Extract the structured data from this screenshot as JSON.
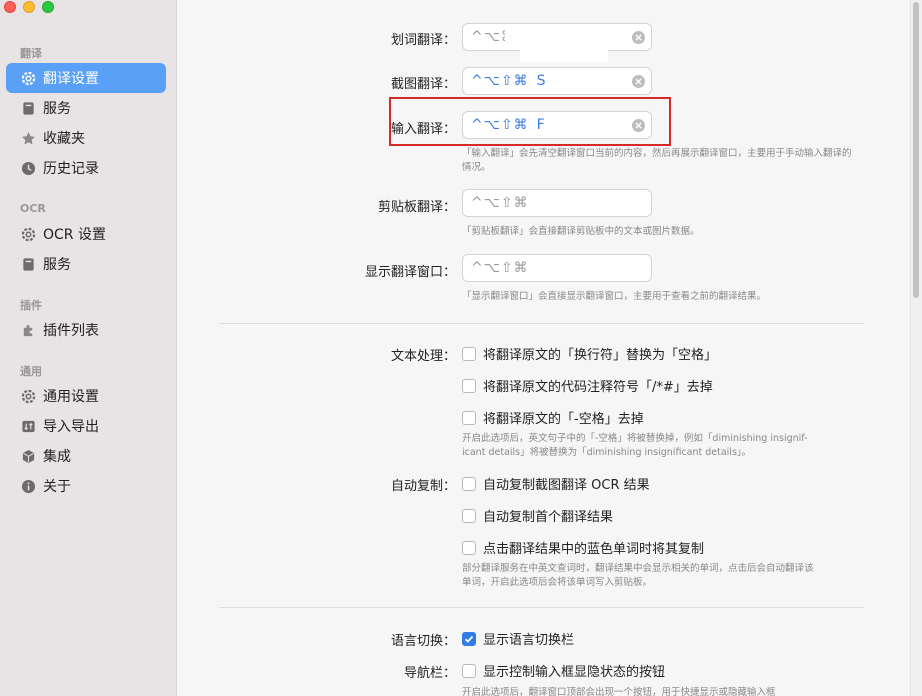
{
  "sidebar": {
    "sections": [
      {
        "title": "翻译",
        "items": [
          {
            "label": "翻译设置",
            "icon": "gear-icon",
            "active": true
          },
          {
            "label": "服务",
            "icon": "bookmark-icon"
          },
          {
            "label": "收藏夹",
            "icon": "star-icon"
          },
          {
            "label": "历史记录",
            "icon": "clock-icon"
          }
        ]
      },
      {
        "title": "OCR",
        "items": [
          {
            "label": "OCR 设置",
            "icon": "gear-icon"
          },
          {
            "label": "服务",
            "icon": "bookmark-icon"
          }
        ]
      },
      {
        "title": "插件",
        "items": [
          {
            "label": "插件列表",
            "icon": "puzzle-icon"
          }
        ]
      },
      {
        "title": "通用",
        "items": [
          {
            "label": "通用设置",
            "icon": "gear-icon"
          },
          {
            "label": "导入导出",
            "icon": "import-export-icon"
          },
          {
            "label": "集成",
            "icon": "cube-icon"
          },
          {
            "label": "关于",
            "icon": "info-icon"
          }
        ]
      }
    ]
  },
  "shortcuts": {
    "word": {
      "label": "划词翻译：",
      "keys": "^⌥⌘",
      "value": ""
    },
    "screenshot": {
      "label": "截图翻译：",
      "keys": "^⌥⇧⌘",
      "value": "S"
    },
    "input": {
      "label": "输入翻译：",
      "keys": "^⌥⇧⌘",
      "value": "F",
      "hint": "「输入翻译」会先清空翻译窗口当前的内容，然后再展示翻译窗口，主要用于手动输入翻译的情况。"
    },
    "clipboard": {
      "label": "剪贴板翻译：",
      "keys": "^⌥⇧⌘",
      "hint": "「剪贴板翻译」会直接翻译剪贴板中的文本或图片数据。"
    },
    "show_window": {
      "label": "显示翻译窗口：",
      "keys": "^⌥⇧⌘",
      "hint": "「显示翻译窗口」会直接显示翻译窗口，主要用于查看之前的翻译结果。"
    }
  },
  "text_processing": {
    "label": "文本处理：",
    "options": [
      {
        "label": "将翻译原文的「换行符」替换为「空格」",
        "checked": false
      },
      {
        "label": "将翻译原文的代码注释符号「/*#」去掉",
        "checked": false
      },
      {
        "label": "将翻译原文的「-空格」去掉",
        "checked": false
      }
    ],
    "hint_line1": "开启此选项后，英文句子中的「-空格」将被替换掉，例如「diminishing insignif-",
    "hint_line2": "icant details」将被替换为「diminishing insignificant details」。"
  },
  "auto_copy": {
    "label": "自动复制：",
    "options": [
      {
        "label": "自动复制截图翻译 OCR 结果",
        "checked": false
      },
      {
        "label": "自动复制首个翻译结果",
        "checked": false
      },
      {
        "label": "点击翻译结果中的蓝色单词时将其复制",
        "checked": false
      }
    ],
    "hint_line1": "部分翻译服务在中英文查词时，翻译结果中会显示相关的单词，点击后会自动翻译该",
    "hint_line2": "单词，开启此选项后会将该单词写入剪贴板。"
  },
  "language_switch": {
    "label": "语言切换：",
    "option": "显示语言切换栏",
    "checked": true
  },
  "navbar": {
    "label": "导航栏：",
    "option": "显示控制输入框显隐状态的按钮",
    "checked": false,
    "hint": "开启此选项后，翻译窗口顶部会出现一个按钮，用于快捷显示或隐藏输入框"
  },
  "colors": {
    "accent": "#5aa0f6",
    "shortcut_blue": "#3a7ce0",
    "highlight_red": "#d52a2a"
  }
}
